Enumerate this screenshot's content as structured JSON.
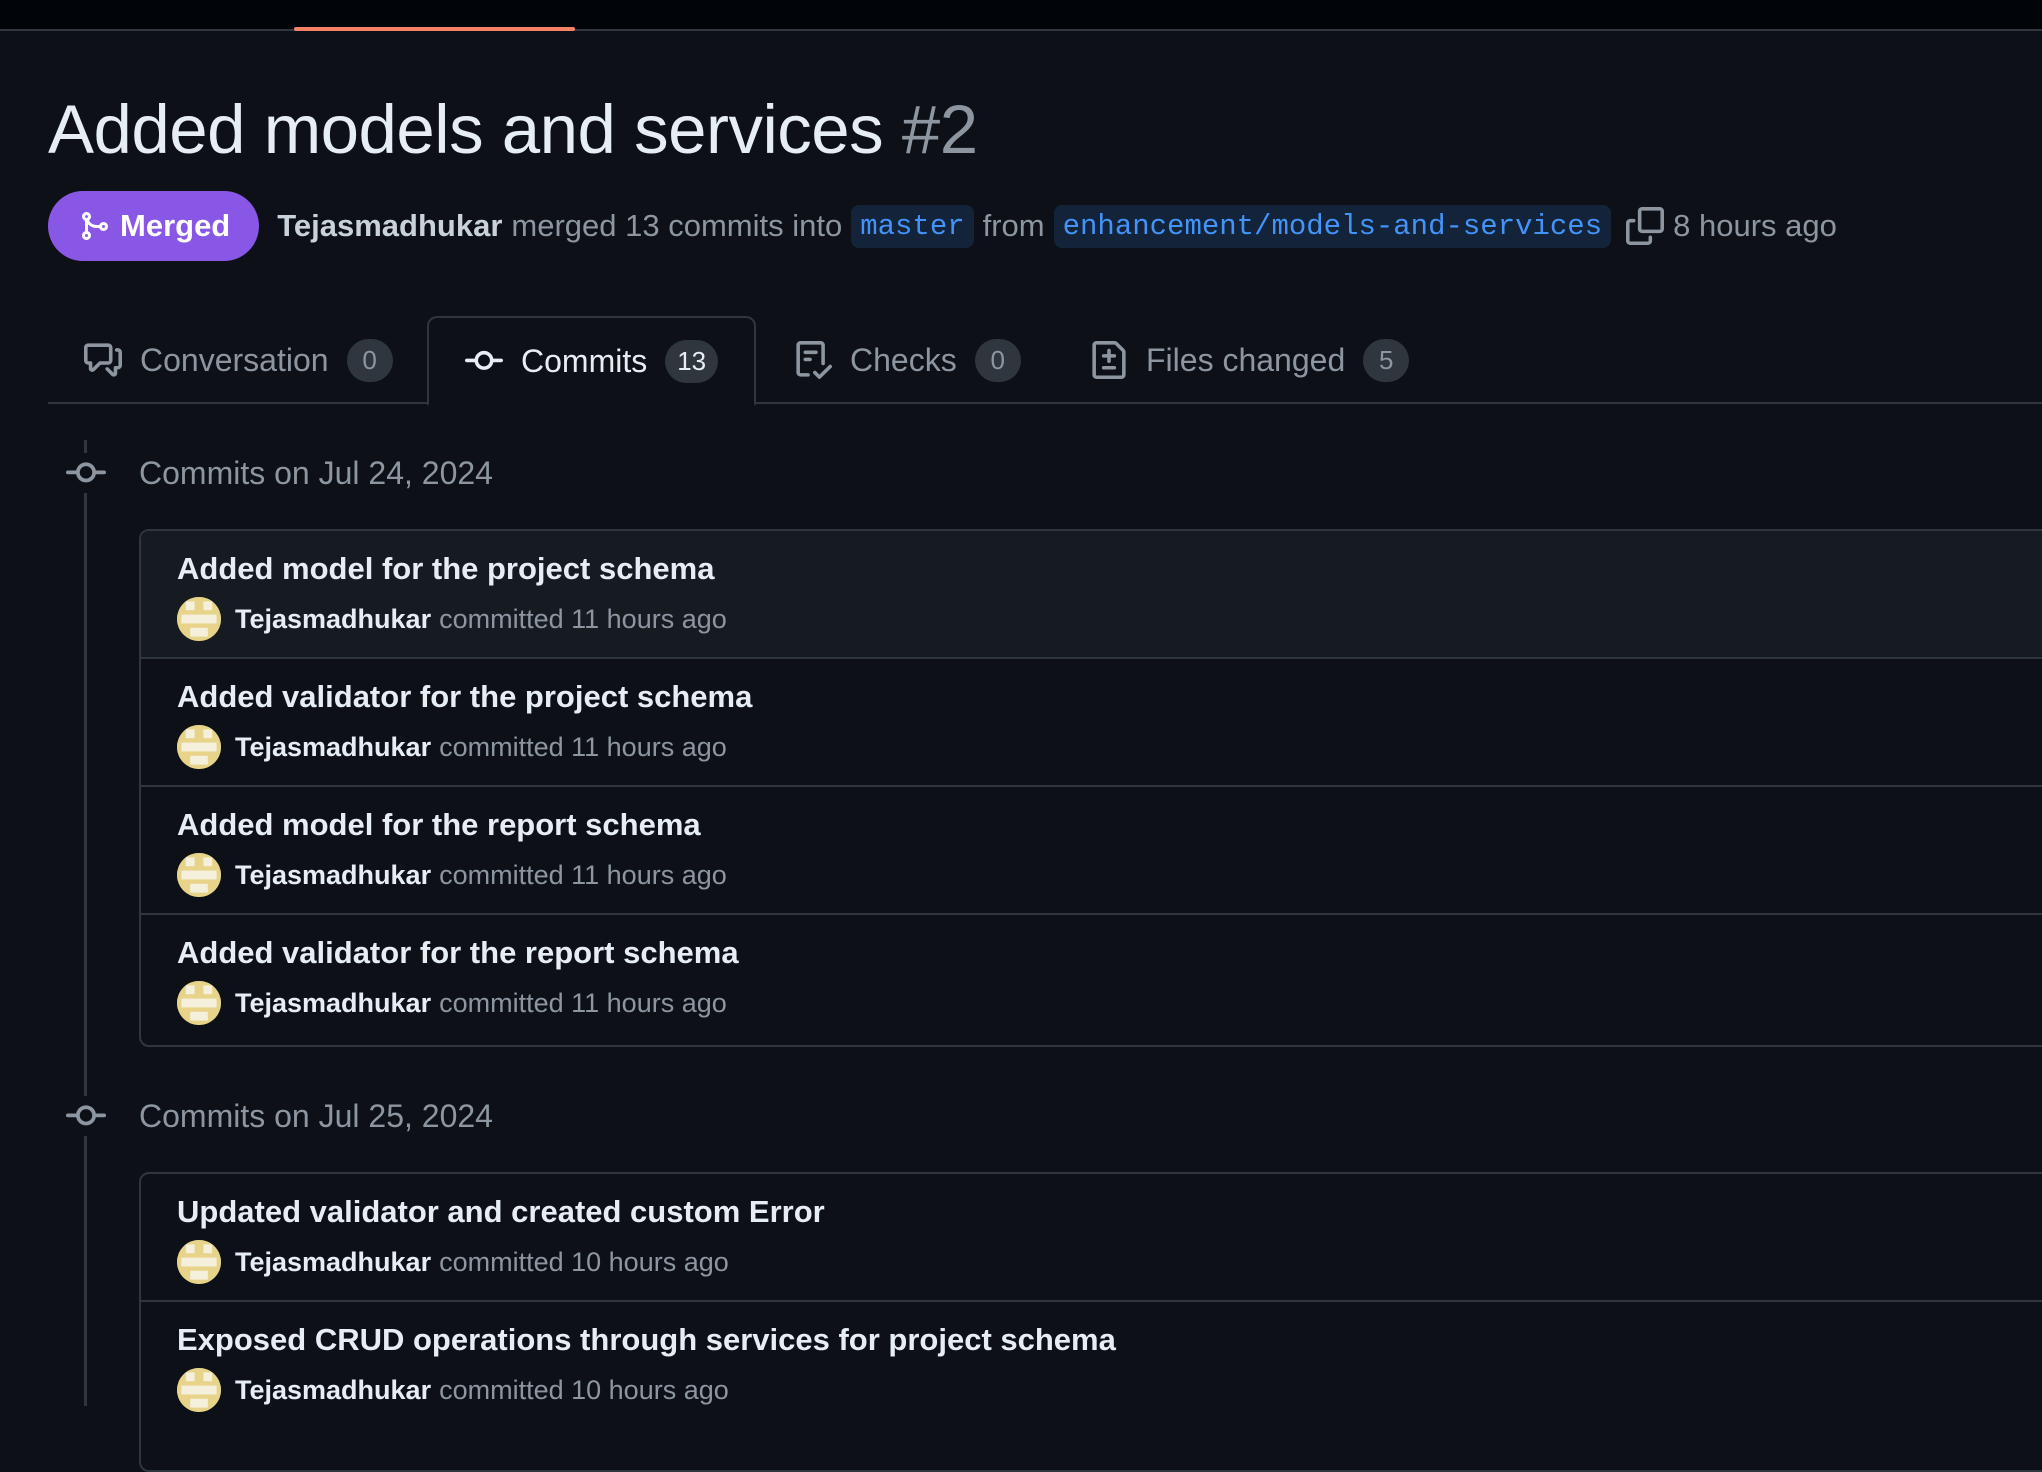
{
  "pr": {
    "title": "Added models and services",
    "number": "#2",
    "status": "Merged",
    "author": "Tejasmadhukar",
    "action_text": "merged 13 commits into",
    "base_branch": "master",
    "from_text": "from",
    "head_branch": "enhancement/models-and-services",
    "time": "8 hours ago"
  },
  "tabs": [
    {
      "label": "Conversation",
      "count": "0",
      "icon": "comment-discussion-icon"
    },
    {
      "label": "Commits",
      "count": "13",
      "icon": "git-commit-icon"
    },
    {
      "label": "Checks",
      "count": "0",
      "icon": "checklist-icon"
    },
    {
      "label": "Files changed",
      "count": "5",
      "icon": "file-diff-icon"
    }
  ],
  "commit_groups": [
    {
      "header": "Commits on Jul 24, 2024",
      "commits": [
        {
          "title": "Added model for the project schema",
          "author": "Tejasmadhukar",
          "action": "committed 11 hours ago"
        },
        {
          "title": "Added validator for the project schema",
          "author": "Tejasmadhukar",
          "action": "committed 11 hours ago"
        },
        {
          "title": "Added model for the report schema",
          "author": "Tejasmadhukar",
          "action": "committed 11 hours ago"
        },
        {
          "title": "Added validator for the report schema",
          "author": "Tejasmadhukar",
          "action": "committed 11 hours ago"
        }
      ]
    },
    {
      "header": "Commits on Jul 25, 2024",
      "commits": [
        {
          "title": "Updated validator and created custom Error",
          "author": "Tejasmadhukar",
          "action": "committed 10 hours ago"
        },
        {
          "title": "Exposed CRUD operations through services for project schema",
          "author": "Tejasmadhukar",
          "action": "committed 10 hours ago"
        }
      ]
    }
  ],
  "colors": {
    "background": "#0d1117",
    "merged_badge": "#8957e5",
    "tab_underline_accent": "#f78166",
    "branch_text": "#4493f8",
    "muted_text": "#8d96a0",
    "avatar": "#e7d48a"
  }
}
